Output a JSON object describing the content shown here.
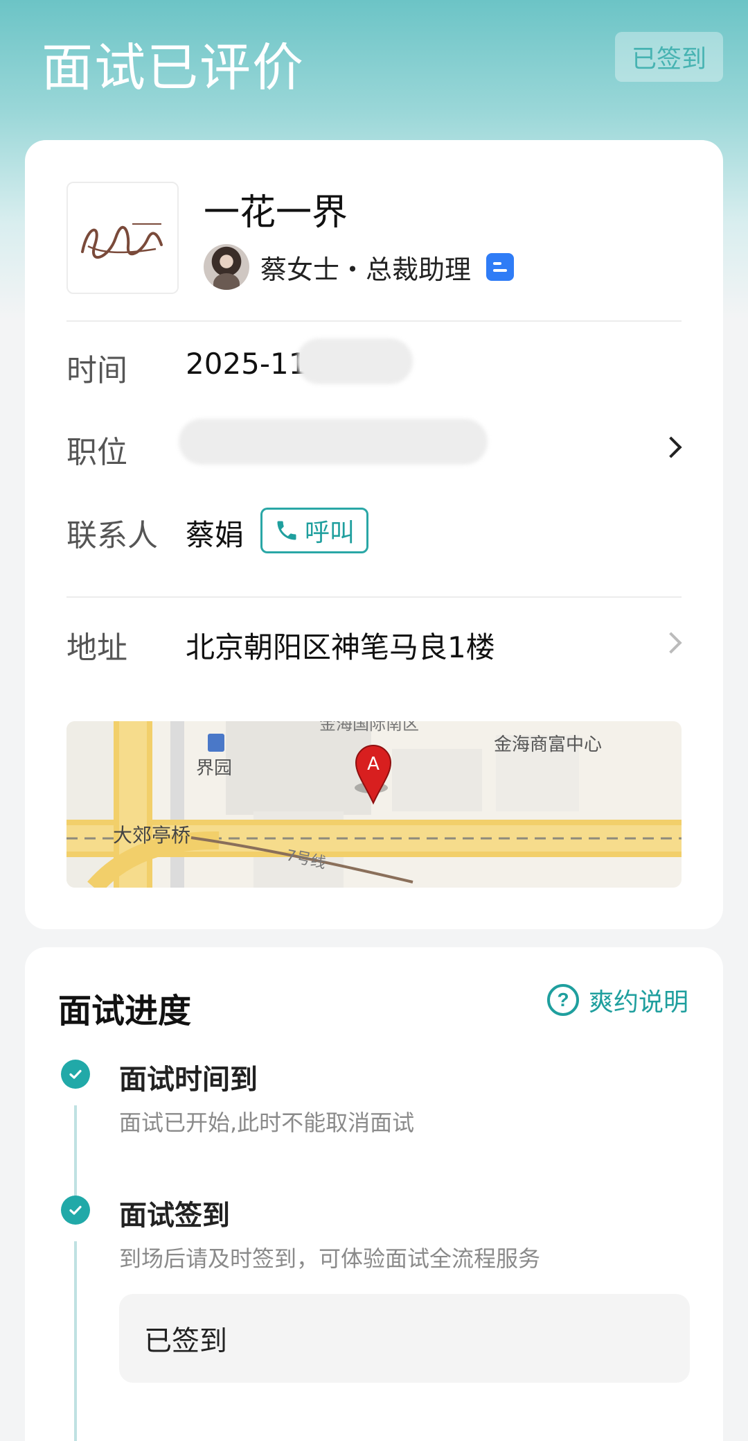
{
  "header": {
    "title": "面试已评价",
    "checkin_button": "已签到"
  },
  "company": {
    "name": "一花一界",
    "logo_text": "一花一界",
    "recruiter": "蔡女士・总裁助理"
  },
  "details": {
    "time_label": "时间",
    "time_value": "2025-11-",
    "position_label": "职位",
    "contact_label": "联系人",
    "contact_name": "蔡娟",
    "call_button": "呼叫",
    "address_label": "地址",
    "address_value": "北京朝阳区神笔马良1楼"
  },
  "map": {
    "labels": [
      "金海国际南区",
      "金海商富中心",
      "界园",
      "大郊亭桥",
      "7号线"
    ],
    "marker": "A"
  },
  "progress": {
    "title": "面试进度",
    "explain_link": "爽约说明",
    "steps": [
      {
        "title": "面试时间到",
        "desc": "面试已开始,此时不能取消面试"
      },
      {
        "title": "面试签到",
        "desc": "到场后请及时签到，可体验面试全流程服务",
        "status": "已签到"
      }
    ]
  },
  "colors": {
    "accent": "#21a9a8",
    "header_gradient_top": "#6cc4c6",
    "badge_blue": "#2f7cf6"
  }
}
